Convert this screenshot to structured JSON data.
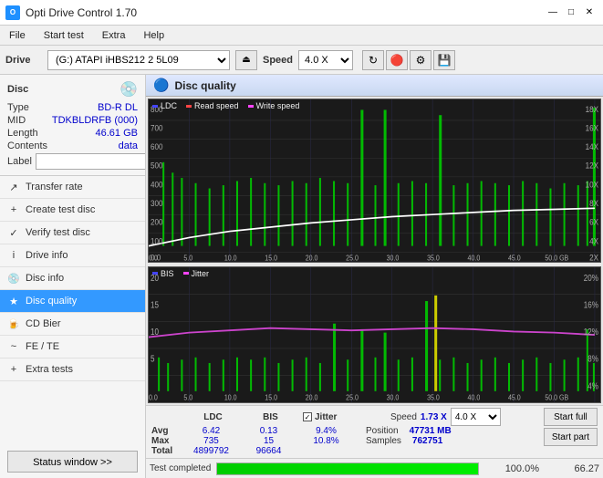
{
  "titlebar": {
    "title": "Opti Drive Control 1.70",
    "icon": "O",
    "minimize": "—",
    "maximize": "□",
    "close": "✕"
  },
  "menubar": {
    "items": [
      "File",
      "Start test",
      "Extra",
      "Help"
    ]
  },
  "drive_toolbar": {
    "drive_label": "Drive",
    "drive_value": "(G:) ATAPI iHBS212 2 5L09",
    "speed_label": "Speed",
    "speed_value": "4.0 X"
  },
  "disc_panel": {
    "title": "Disc",
    "type_label": "Type",
    "type_value": "BD-R DL",
    "mid_label": "MID",
    "mid_value": "TDKBLDRFB (000)",
    "length_label": "Length",
    "length_value": "46.61 GB",
    "contents_label": "Contents",
    "contents_value": "data",
    "label_label": "Label",
    "label_value": ""
  },
  "nav_items": [
    {
      "id": "transfer-rate",
      "label": "Transfer rate",
      "icon": "↗"
    },
    {
      "id": "create-test",
      "label": "Create test disc",
      "icon": "+"
    },
    {
      "id": "verify-test",
      "label": "Verify test disc",
      "icon": "✓"
    },
    {
      "id": "drive-info",
      "label": "Drive info",
      "icon": "i"
    },
    {
      "id": "disc-info",
      "label": "Disc info",
      "icon": "💿"
    },
    {
      "id": "disc-quality",
      "label": "Disc quality",
      "icon": "★",
      "active": true
    },
    {
      "id": "cd-bier",
      "label": "CD Bier",
      "icon": "🍺"
    },
    {
      "id": "fe-te",
      "label": "FE / TE",
      "icon": "~"
    },
    {
      "id": "extra-tests",
      "label": "Extra tests",
      "icon": "+"
    }
  ],
  "status_btn": "Status window >>",
  "disc_quality": {
    "title": "Disc quality",
    "legend_top": [
      "LDC",
      "Read speed",
      "Write speed"
    ],
    "legend_bottom": [
      "BIS",
      "Jitter"
    ],
    "y_axis_top": [
      800,
      700,
      600,
      500,
      400,
      300,
      200,
      100,
      "0.0"
    ],
    "y_axis_top_right": [
      "18X",
      "16X",
      "14X",
      "12X",
      "10X",
      "8X",
      "6X",
      "4X",
      "2X"
    ],
    "y_axis_bottom": [
      20,
      15,
      10,
      5
    ],
    "y_axis_bottom_right": [
      "20%",
      "16%",
      "12%",
      "8%",
      "4%"
    ],
    "x_axis": [
      "0.0",
      "5.0",
      "10.0",
      "15.0",
      "20.0",
      "25.0",
      "30.0",
      "35.0",
      "40.0",
      "45.0",
      "50.0 GB"
    ]
  },
  "stats": {
    "col_ldc": "LDC",
    "col_bis": "BIS",
    "col_jitter": "Jitter",
    "jitter_checked": true,
    "avg_label": "Avg",
    "avg_ldc": "6.42",
    "avg_bis": "0.13",
    "avg_jitter": "9.4%",
    "max_label": "Max",
    "max_ldc": "735",
    "max_bis": "15",
    "max_jitter": "10.8%",
    "total_label": "Total",
    "total_ldc": "4899792",
    "total_bis": "96664",
    "speed_label": "Speed",
    "speed_value": "1.73 X",
    "speed_select": "4.0 X",
    "position_label": "Position",
    "position_value": "47731 MB",
    "samples_label": "Samples",
    "samples_value": "762751",
    "start_full_btn": "Start full",
    "start_part_btn": "Start part"
  },
  "progress": {
    "status_text": "Test completed",
    "percent": "100.0%",
    "fill_percent": 100,
    "right_value": "66.27"
  }
}
